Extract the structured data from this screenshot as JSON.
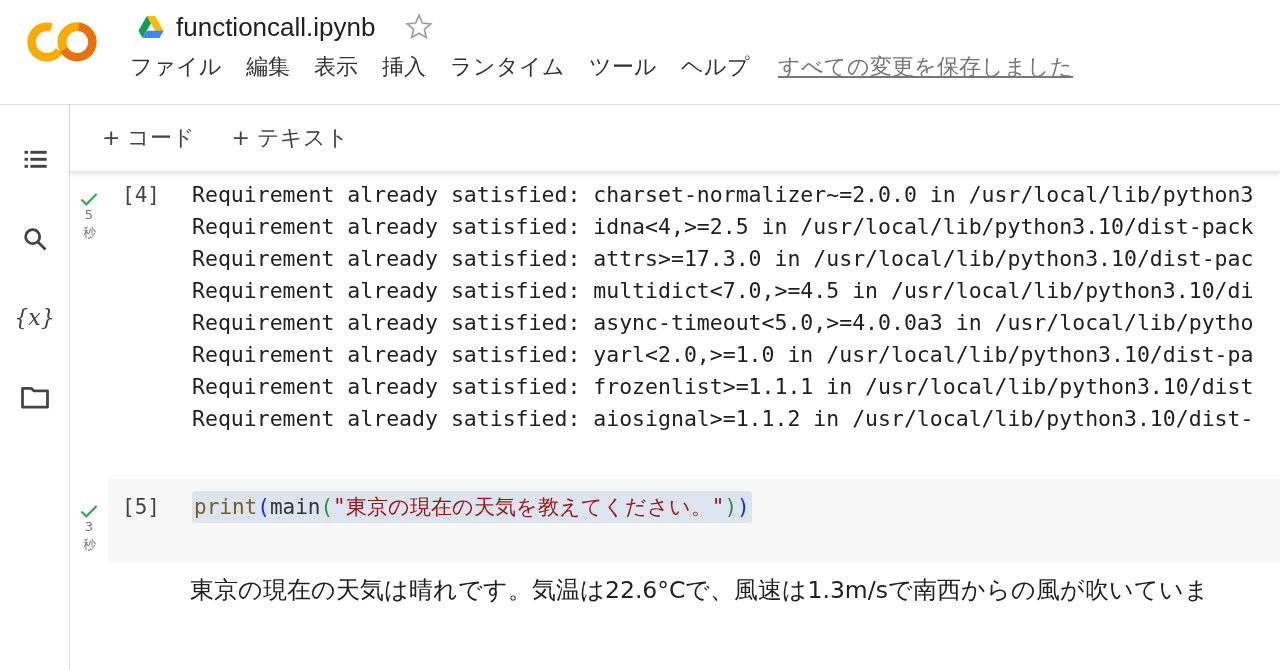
{
  "notebook": {
    "title": "functioncall.ipynb",
    "starred": false
  },
  "menu": [
    "ファイル",
    "編集",
    "表示",
    "挿入",
    "ランタイム",
    "ツール",
    "ヘルプ"
  ],
  "save_status": "すべての変更を保存しました",
  "sidebar": [
    {
      "kind": "toc"
    },
    {
      "kind": "search"
    },
    {
      "kind": "variables",
      "label": "{x}"
    },
    {
      "kind": "files"
    }
  ],
  "toolbar": [
    "+ コード",
    "+ テキスト"
  ],
  "cells": [
    {
      "done": true,
      "duration": "5",
      "unit": "秒",
      "count": "[4]",
      "output": [
        "Requirement already satisfied: charset-normalizer~=2.0.0 in /usr/local/lib/python3",
        "Requirement already satisfied: idna<4,>=2.5 in /usr/local/lib/python3.10/dist-pack",
        "Requirement already satisfied: attrs>=17.3.0 in /usr/local/lib/python3.10/dist-pac",
        "Requirement already satisfied: multidict<7.0,>=4.5 in /usr/local/lib/python3.10/di",
        "Requirement already satisfied: async-timeout<5.0,>=4.0.0a3 in /usr/local/lib/pytho",
        "Requirement already satisfied: yarl<2.0,>=1.0 in /usr/local/lib/python3.10/dist-pa",
        "Requirement already satisfied: frozenlist>=1.1.1 in /usr/local/lib/python3.10/dist",
        "Requirement already satisfied: aiosignal>=1.1.2 in /usr/local/lib/python3.10/dist-"
      ]
    },
    {
      "done": true,
      "duration": "3",
      "unit": "秒",
      "count": "[5]",
      "code": [
        {
          "text": "print",
          "kind": "builtin"
        },
        {
          "text": "(",
          "kind": "paren1"
        },
        {
          "text": "main",
          "kind": "name"
        },
        {
          "text": "(",
          "kind": "paren2"
        },
        {
          "text": "\"東京の現在の天気を教えてください。\"",
          "kind": "string"
        },
        {
          "text": ")",
          "kind": "paren2"
        },
        {
          "text": ")",
          "kind": "paren1"
        }
      ],
      "output": [
        "東京の現在の天気は晴れです。気温は22.6°Cで、風速は1.3m/sで南西からの風が吹いていま"
      ]
    }
  ]
}
